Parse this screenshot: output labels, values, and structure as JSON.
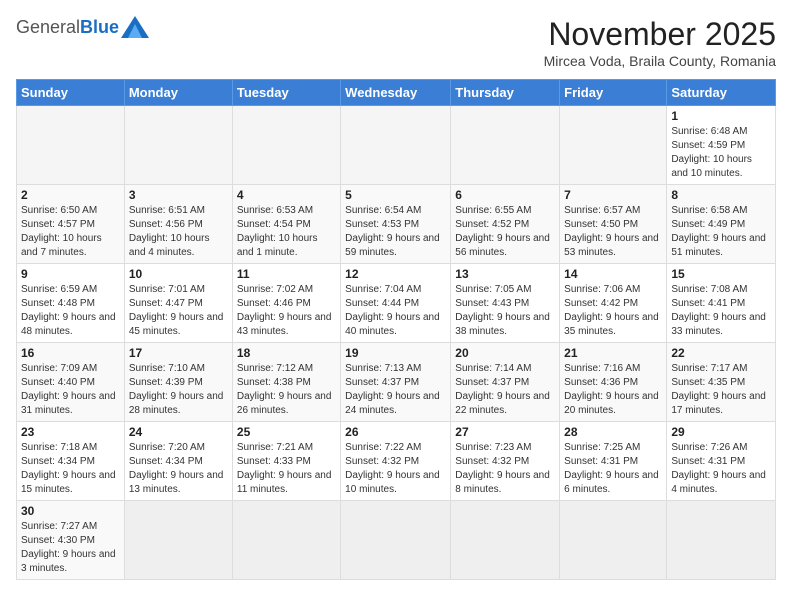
{
  "header": {
    "logo_general": "General",
    "logo_blue": "Blue",
    "month_title": "November 2025",
    "location": "Mircea Voda, Braila County, Romania"
  },
  "columns": [
    "Sunday",
    "Monday",
    "Tuesday",
    "Wednesday",
    "Thursday",
    "Friday",
    "Saturday"
  ],
  "weeks": [
    [
      {
        "day": "",
        "info": ""
      },
      {
        "day": "",
        "info": ""
      },
      {
        "day": "",
        "info": ""
      },
      {
        "day": "",
        "info": ""
      },
      {
        "day": "",
        "info": ""
      },
      {
        "day": "",
        "info": ""
      },
      {
        "day": "1",
        "info": "Sunrise: 6:48 AM\nSunset: 4:59 PM\nDaylight: 10 hours and 10 minutes."
      }
    ],
    [
      {
        "day": "2",
        "info": "Sunrise: 6:50 AM\nSunset: 4:57 PM\nDaylight: 10 hours and 7 minutes."
      },
      {
        "day": "3",
        "info": "Sunrise: 6:51 AM\nSunset: 4:56 PM\nDaylight: 10 hours and 4 minutes."
      },
      {
        "day": "4",
        "info": "Sunrise: 6:53 AM\nSunset: 4:54 PM\nDaylight: 10 hours and 1 minute."
      },
      {
        "day": "5",
        "info": "Sunrise: 6:54 AM\nSunset: 4:53 PM\nDaylight: 9 hours and 59 minutes."
      },
      {
        "day": "6",
        "info": "Sunrise: 6:55 AM\nSunset: 4:52 PM\nDaylight: 9 hours and 56 minutes."
      },
      {
        "day": "7",
        "info": "Sunrise: 6:57 AM\nSunset: 4:50 PM\nDaylight: 9 hours and 53 minutes."
      },
      {
        "day": "8",
        "info": "Sunrise: 6:58 AM\nSunset: 4:49 PM\nDaylight: 9 hours and 51 minutes."
      }
    ],
    [
      {
        "day": "9",
        "info": "Sunrise: 6:59 AM\nSunset: 4:48 PM\nDaylight: 9 hours and 48 minutes."
      },
      {
        "day": "10",
        "info": "Sunrise: 7:01 AM\nSunset: 4:47 PM\nDaylight: 9 hours and 45 minutes."
      },
      {
        "day": "11",
        "info": "Sunrise: 7:02 AM\nSunset: 4:46 PM\nDaylight: 9 hours and 43 minutes."
      },
      {
        "day": "12",
        "info": "Sunrise: 7:04 AM\nSunset: 4:44 PM\nDaylight: 9 hours and 40 minutes."
      },
      {
        "day": "13",
        "info": "Sunrise: 7:05 AM\nSunset: 4:43 PM\nDaylight: 9 hours and 38 minutes."
      },
      {
        "day": "14",
        "info": "Sunrise: 7:06 AM\nSunset: 4:42 PM\nDaylight: 9 hours and 35 minutes."
      },
      {
        "day": "15",
        "info": "Sunrise: 7:08 AM\nSunset: 4:41 PM\nDaylight: 9 hours and 33 minutes."
      }
    ],
    [
      {
        "day": "16",
        "info": "Sunrise: 7:09 AM\nSunset: 4:40 PM\nDaylight: 9 hours and 31 minutes."
      },
      {
        "day": "17",
        "info": "Sunrise: 7:10 AM\nSunset: 4:39 PM\nDaylight: 9 hours and 28 minutes."
      },
      {
        "day": "18",
        "info": "Sunrise: 7:12 AM\nSunset: 4:38 PM\nDaylight: 9 hours and 26 minutes."
      },
      {
        "day": "19",
        "info": "Sunrise: 7:13 AM\nSunset: 4:37 PM\nDaylight: 9 hours and 24 minutes."
      },
      {
        "day": "20",
        "info": "Sunrise: 7:14 AM\nSunset: 4:37 PM\nDaylight: 9 hours and 22 minutes."
      },
      {
        "day": "21",
        "info": "Sunrise: 7:16 AM\nSunset: 4:36 PM\nDaylight: 9 hours and 20 minutes."
      },
      {
        "day": "22",
        "info": "Sunrise: 7:17 AM\nSunset: 4:35 PM\nDaylight: 9 hours and 17 minutes."
      }
    ],
    [
      {
        "day": "23",
        "info": "Sunrise: 7:18 AM\nSunset: 4:34 PM\nDaylight: 9 hours and 15 minutes."
      },
      {
        "day": "24",
        "info": "Sunrise: 7:20 AM\nSunset: 4:34 PM\nDaylight: 9 hours and 13 minutes."
      },
      {
        "day": "25",
        "info": "Sunrise: 7:21 AM\nSunset: 4:33 PM\nDaylight: 9 hours and 11 minutes."
      },
      {
        "day": "26",
        "info": "Sunrise: 7:22 AM\nSunset: 4:32 PM\nDaylight: 9 hours and 10 minutes."
      },
      {
        "day": "27",
        "info": "Sunrise: 7:23 AM\nSunset: 4:32 PM\nDaylight: 9 hours and 8 minutes."
      },
      {
        "day": "28",
        "info": "Sunrise: 7:25 AM\nSunset: 4:31 PM\nDaylight: 9 hours and 6 minutes."
      },
      {
        "day": "29",
        "info": "Sunrise: 7:26 AM\nSunset: 4:31 PM\nDaylight: 9 hours and 4 minutes."
      }
    ],
    [
      {
        "day": "30",
        "info": "Sunrise: 7:27 AM\nSunset: 4:30 PM\nDaylight: 9 hours and 3 minutes."
      },
      {
        "day": "",
        "info": ""
      },
      {
        "day": "",
        "info": ""
      },
      {
        "day": "",
        "info": ""
      },
      {
        "day": "",
        "info": ""
      },
      {
        "day": "",
        "info": ""
      },
      {
        "day": "",
        "info": ""
      }
    ]
  ]
}
